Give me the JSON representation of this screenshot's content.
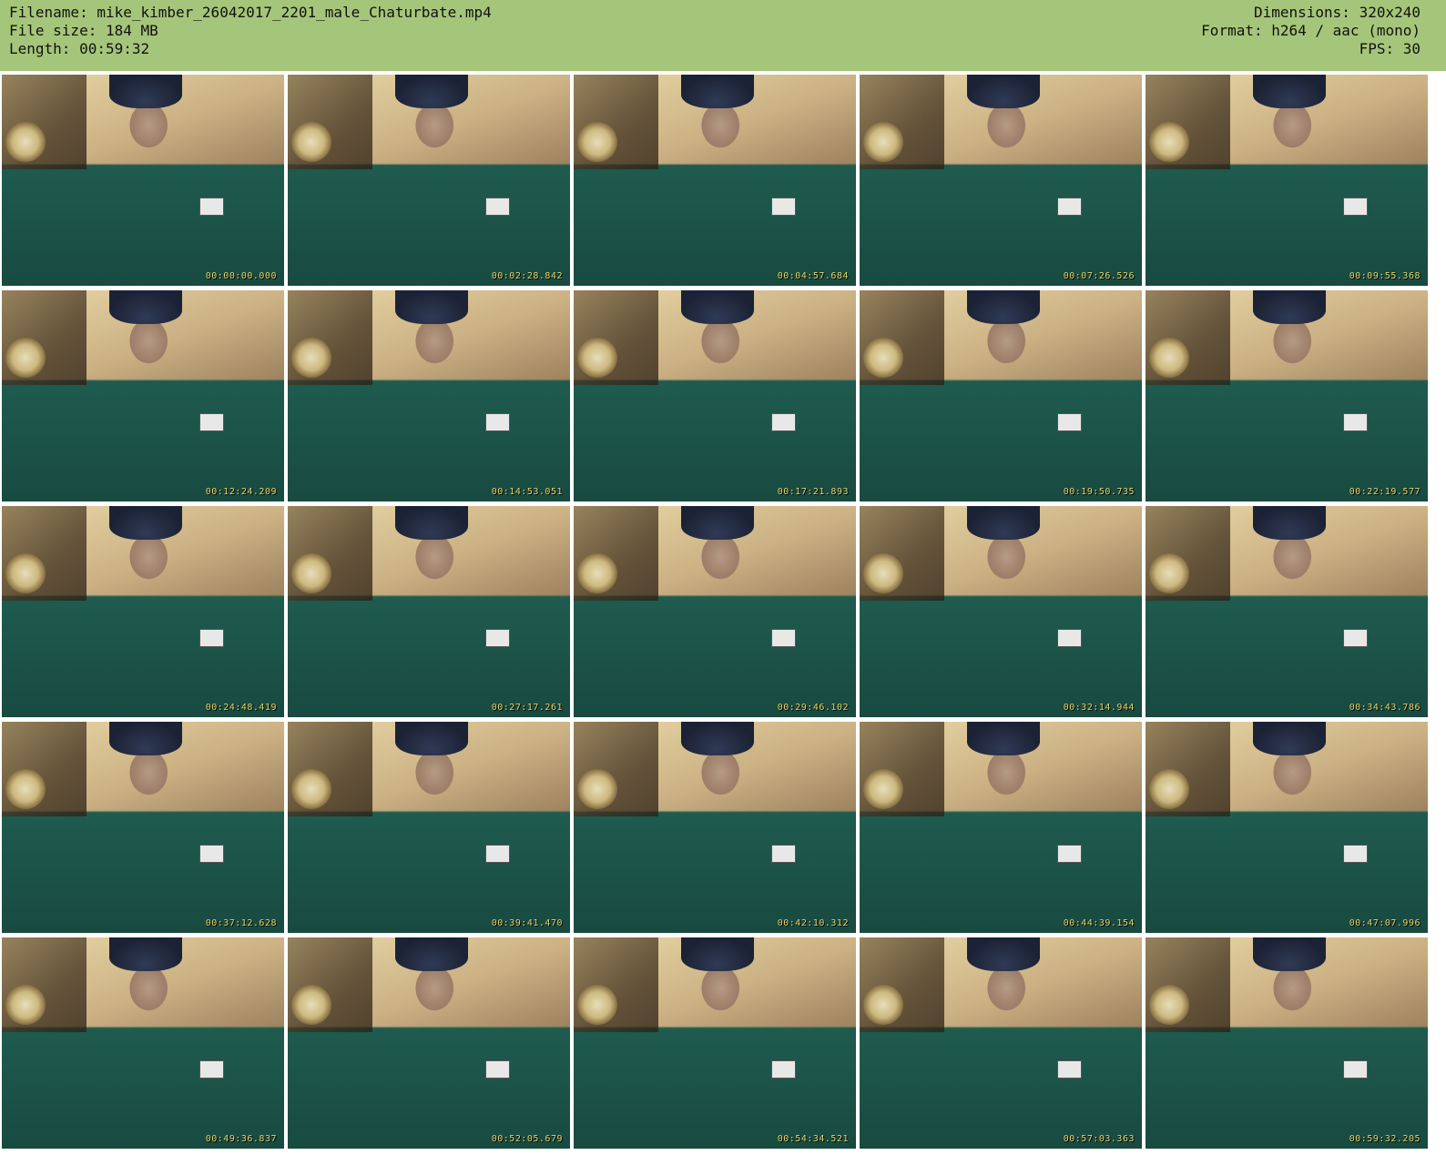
{
  "header": {
    "filename": "Filename: mike_kimber_26042017_2201_male_Chaturbate.mp4",
    "filesize": "File size: 184 MB",
    "length": "Length: 00:59:32",
    "dimensions": "Dimensions: 320x240",
    "format": "Format: h264 / aac (mono)",
    "fps": "FPS: 30",
    "background_color": "#a5c67a"
  },
  "thumbnails": [
    {
      "timestamp": "00:00:00.000"
    },
    {
      "timestamp": "00:02:28.842"
    },
    {
      "timestamp": "00:04:57.684"
    },
    {
      "timestamp": "00:07:26.526"
    },
    {
      "timestamp": "00:09:55.368"
    },
    {
      "timestamp": "00:12:24.209"
    },
    {
      "timestamp": "00:14:53.051"
    },
    {
      "timestamp": "00:17:21.893"
    },
    {
      "timestamp": "00:19:50.735"
    },
    {
      "timestamp": "00:22:19.577"
    },
    {
      "timestamp": "00:24:48.419"
    },
    {
      "timestamp": "00:27:17.261"
    },
    {
      "timestamp": "00:29:46.102"
    },
    {
      "timestamp": "00:32:14.944"
    },
    {
      "timestamp": "00:34:43.786"
    },
    {
      "timestamp": "00:37:12.628"
    },
    {
      "timestamp": "00:39:41.470"
    },
    {
      "timestamp": "00:42:10.312"
    },
    {
      "timestamp": "00:44:39.154"
    },
    {
      "timestamp": "00:47:07.996"
    },
    {
      "timestamp": "00:49:36.837"
    },
    {
      "timestamp": "00:52:05.679"
    },
    {
      "timestamp": "00:54:34.521"
    },
    {
      "timestamp": "00:57:03.363"
    },
    {
      "timestamp": "00:59:32.205"
    }
  ]
}
